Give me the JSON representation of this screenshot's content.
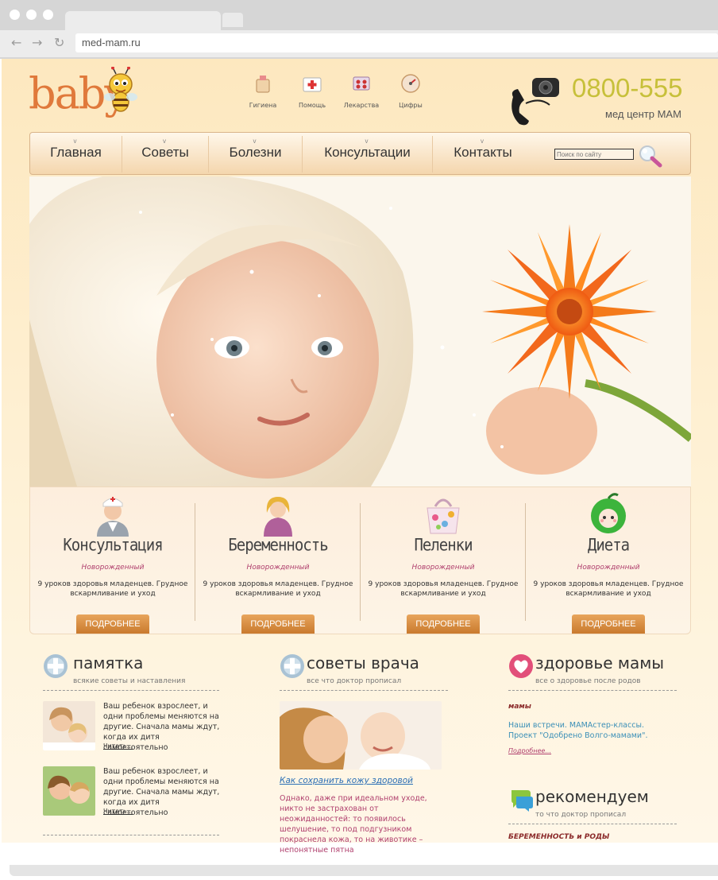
{
  "browser": {
    "url": "med-mam.ru"
  },
  "logo": {
    "text": "baby"
  },
  "top_icons": [
    {
      "label": "Гигиена",
      "icon": "hygiene-icon"
    },
    {
      "label": "Помощь",
      "icon": "first-aid-icon"
    },
    {
      "label": "Лекарства",
      "icon": "medicine-icon"
    },
    {
      "label": "Цифры",
      "icon": "gauge-icon"
    }
  ],
  "contact": {
    "phone": "0800-555",
    "center": "мед центр МАМ"
  },
  "nav": {
    "items": [
      {
        "label": "Главная",
        "marker": "v"
      },
      {
        "label": "Советы",
        "marker": "v"
      },
      {
        "label": "Болезни",
        "marker": "v"
      },
      {
        "label": "Консультации",
        "marker": "v"
      },
      {
        "label": "Контакты",
        "marker": "v"
      }
    ],
    "search_placeholder": "Поиск по сайту"
  },
  "cards": [
    {
      "title": "Консультация",
      "category": "Новорожденный",
      "text": "9 уроков здоровья младенцев. Грудное вскармливание и уход",
      "button": "ПОДРОБНЕЕ",
      "icon": "doctor-icon"
    },
    {
      "title": "Беременность",
      "category": "Новорожденный",
      "text": "9 уроков здоровья младенцев. Грудное вскармливание и уход",
      "button": "ПОДРОБНЕЕ",
      "icon": "pregnant-woman-icon"
    },
    {
      "title": "Пеленки",
      "category": "Новорожденный",
      "text": "9 уроков здоровья младенцев. Грудное вскармливание и уход",
      "button": "ПОДРОБНЕЕ",
      "icon": "baby-bag-icon"
    },
    {
      "title": "Диета",
      "category": "Новорожденный",
      "text": "9 уроков здоровья младенцев. Грудное вскармливание и уход",
      "button": "ПОДРОБНЕЕ",
      "icon": "apple-face-icon"
    }
  ],
  "memo": {
    "title": "памятка",
    "subtitle": "всякие советы и наставления",
    "items": [
      {
        "text": "Ваш ребенок взрослеет, и одни проблемы меняются на другие. Сначала мамы ждут, когда их дитя самостоятельно",
        "more": "Читать..."
      },
      {
        "text": "Ваш ребенок взрослеет, и одни проблемы меняются на другие. Сначала мамы ждут, когда их дитя самостоятельно",
        "more": "Читать..."
      }
    ]
  },
  "doctor": {
    "title": "советы врача",
    "subtitle": "все что доктор прописал",
    "link": "Как сохранить кожу здоровой",
    "text": "Однако, даже при идеальном уходе, никто не застрахован от неожиданностей: то появилось шелушение, то под подгузником покраснела кожа, то на животике – непонятные пятна"
  },
  "mom": {
    "title": "здоровье мамы",
    "subtitle": "все о здоровье после родов",
    "category": "мамы",
    "text": "Наши встречи. МАМАстер-классы. Проект \"Одобрено Волго-мамами\".",
    "more": "Подробнее..."
  },
  "recommend": {
    "title": "рекомендуем",
    "subtitle": "то что доктор прописал",
    "category": "БЕРЕМЕННОСТЬ и РОДЫ"
  },
  "colors": {
    "accent_orange": "#e0793b",
    "phone_green": "#c7c03a",
    "link_blue": "#2b6fb5",
    "pink": "#b0406e"
  }
}
